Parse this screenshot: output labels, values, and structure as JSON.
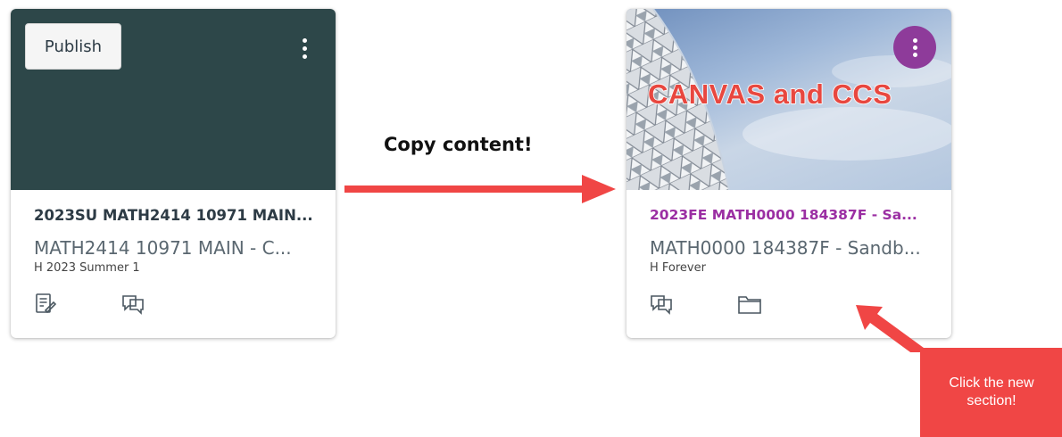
{
  "cards": [
    {
      "publish_label": "Publish",
      "title": "2023SU MATH2414 10971 MAIN...",
      "subtitle": "MATH2414 10971 MAIN - C...",
      "term": "H 2023 Summer 1",
      "hero_color": "#2d4749",
      "icons": [
        "assignments-icon",
        "discussions-icon"
      ]
    },
    {
      "hero_text": "CANVAS and CCS",
      "title": "2023FE MATH0000 184387F - Sa...",
      "subtitle": "MATH0000 184387F - Sandb...",
      "term": "H Forever",
      "accent_color": "#9b2fa3",
      "icons": [
        "discussions-icon",
        "files-icon"
      ]
    }
  ],
  "annotations": {
    "copy_label": "Copy content!",
    "callout_line1": "Click the new",
    "callout_line2": "section!",
    "arrow_color": "#f04645"
  }
}
